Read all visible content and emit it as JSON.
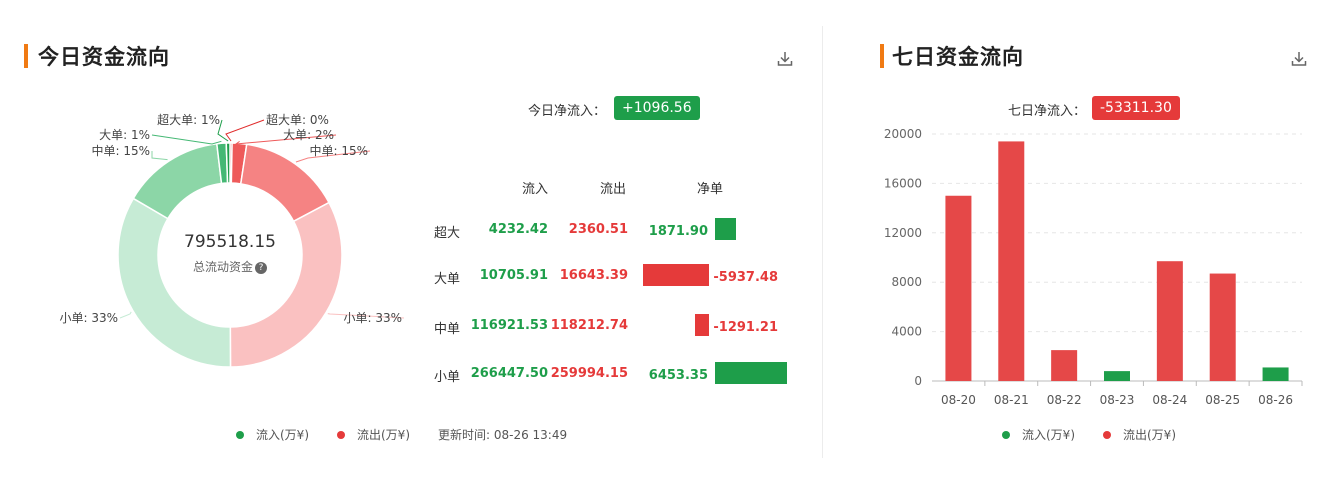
{
  "today": {
    "title": "今日资金流向",
    "net_label": "今日净流入：",
    "net_value": "+1096.56",
    "center_value": "795518.15",
    "center_label": "总流动资金",
    "help_icon": "question-icon",
    "table": {
      "headers": [
        "流入",
        "流出",
        "净单"
      ],
      "rows": [
        {
          "label": "超大",
          "inflow": "4232.42",
          "outflow": "2360.51",
          "net": "1871.90",
          "net_value": 1871.9
        },
        {
          "label": "大单",
          "inflow": "10705.91",
          "outflow": "16643.39",
          "net": "-5937.48",
          "net_value": -5937.48
        },
        {
          "label": "中单",
          "inflow": "116921.53",
          "outflow": "118212.74",
          "net": "-1291.21",
          "net_value": -1291.21
        },
        {
          "label": "小单",
          "inflow": "266447.50",
          "outflow": "259994.15",
          "net": "6453.35",
          "net_value": 6453.35
        }
      ]
    },
    "legend": {
      "inflow": "流入(万¥)",
      "outflow": "流出(万¥)",
      "update": "更新时间: 08-26 13:49"
    }
  },
  "seven_day": {
    "title": "七日资金流向",
    "net_label": "七日净流入：",
    "net_value": "-53311.30",
    "legend": {
      "inflow": "流入(万¥)",
      "outflow": "流出(万¥)"
    }
  },
  "colors": {
    "inflow": "#1e9e4a",
    "outflow": "#e53a3a",
    "accent": "#f07a13",
    "donut": {
      "超大单流出": "#e02c2c",
      "大单流出": "#ee5a5a",
      "中单流出": "#f58383",
      "小单流出": "#fac1c1",
      "小单流入": "#c6ebd5",
      "中单流入": "#8cd6a7",
      "大单流入": "#45b874",
      "超大单流入": "#1e9e4a"
    }
  },
  "chart_data": [
    {
      "type": "pie",
      "title": "",
      "slices": [
        {
          "label": "超大单: 0%",
          "side": "out",
          "value": 2360.51
        },
        {
          "label": "大单: 2%",
          "side": "out",
          "value": 16643.39
        },
        {
          "label": "中单: 15%",
          "side": "out",
          "value": 118212.74
        },
        {
          "label": "小单: 33%",
          "side": "out",
          "value": 259994.15
        },
        {
          "label": "小单: 33%",
          "side": "in",
          "value": 266447.5
        },
        {
          "label": "中单: 15%",
          "side": "in",
          "value": 116921.53
        },
        {
          "label": "大单: 1%",
          "side": "in",
          "value": 10705.91
        },
        {
          "label": "超大单: 1%",
          "side": "in",
          "value": 4232.42
        }
      ]
    },
    {
      "type": "bar",
      "title": "",
      "categories": [
        "08-20",
        "08-21",
        "08-22",
        "08-23",
        "08-24",
        "08-25",
        "08-26"
      ],
      "values": [
        -15000,
        -19400,
        -2500,
        800,
        -9700,
        -8700,
        1097
      ],
      "bar_heights_abs": [
        15000,
        19400,
        2500,
        800,
        9700,
        8700,
        1097
      ],
      "colors_by_sign": {
        "positive": "#1e9e4a",
        "negative": "#e54848"
      },
      "yticks": [
        0,
        4000,
        8000,
        12000,
        16000,
        20000
      ],
      "ylim": [
        0,
        20000
      ],
      "grid": true,
      "xlabel": "",
      "ylabel": ""
    }
  ]
}
